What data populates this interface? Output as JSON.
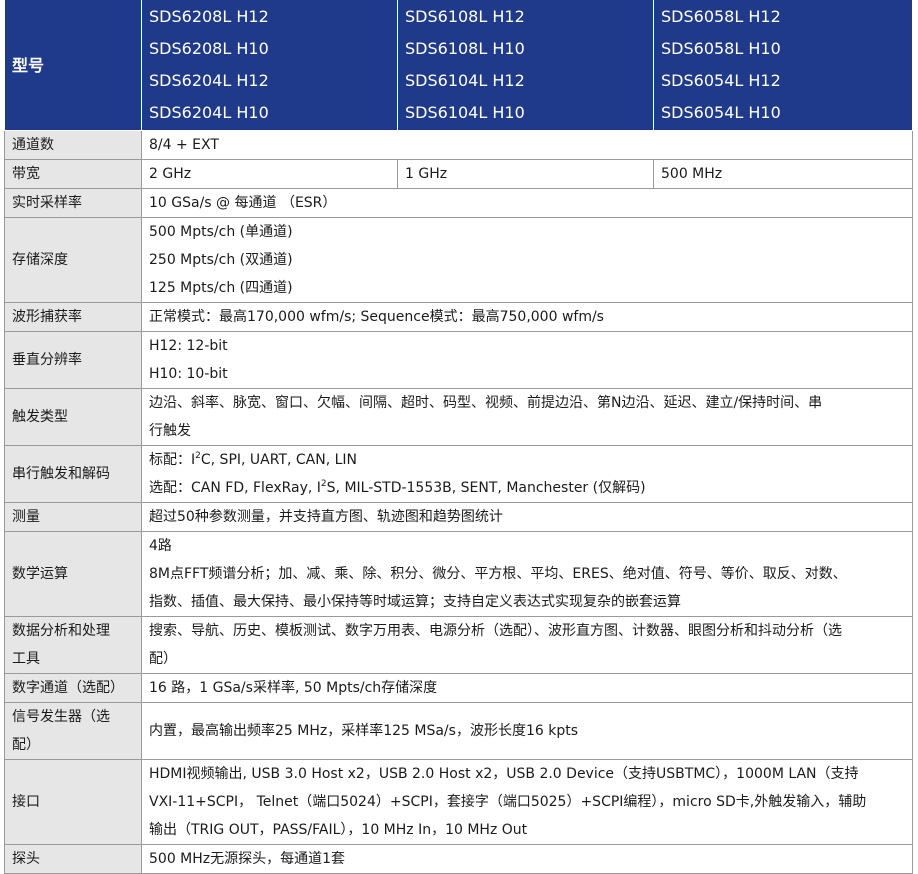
{
  "header": {
    "label": "型号",
    "models": [
      [
        "SDS6208L H12",
        "SDS6208L H10",
        "SDS6204L H12",
        "SDS6204L H10"
      ],
      [
        "SDS6108L H12",
        "SDS6108L H10",
        "SDS6104L H12",
        "SDS6104L H10"
      ],
      [
        "SDS6058L H12",
        "SDS6058L H10",
        "SDS6054L H12",
        "SDS6054L H10"
      ]
    ]
  },
  "rows": {
    "channels": {
      "label": "通道数",
      "value": "8/4 + EXT"
    },
    "bandwidth": {
      "label": "带宽",
      "values": [
        "2 GHz",
        "1 GHz",
        "500 MHz"
      ]
    },
    "sample_rate": {
      "label": "实时采样率",
      "value": "10 GSa/s @ 每通道 （ESR）"
    },
    "memory": {
      "label": "存储深度",
      "lines": [
        "500 Mpts/ch (单通道)",
        "250 Mpts/ch (双通道)",
        "125 Mpts/ch (四通道)"
      ]
    },
    "capture_rate": {
      "label": "波形捕获率",
      "value": "正常模式：最高170,000 wfm/s; Sequence模式：最高750,000 wfm/s"
    },
    "resolution": {
      "label": "垂直分辨率",
      "lines": [
        "H12: 12-bit",
        "H10: 10-bit"
      ]
    },
    "trigger": {
      "label": "触发类型",
      "lines": [
        "边沿、斜率、脉宽、窗口、欠幅、间隔、超时、码型、视频、前提边沿、第N边沿、延迟、建立/保持时间、串",
        "行触发"
      ]
    },
    "serial": {
      "label": "串行触发和解码",
      "line1_prefix": "标配：I",
      "line1_sup": "2",
      "line1_suffix": "C, SPI, UART, CAN, LIN",
      "line2_prefix": "选配：CAN FD, FlexRay, I",
      "line2_sup": "2",
      "line2_suffix": "S, MIL-STD-1553B, SENT, Manchester (仅解码)"
    },
    "measure": {
      "label": "测量",
      "value": "超过50种参数测量，并支持直方图、轨迹图和趋势图统计"
    },
    "math": {
      "label": "数学运算",
      "lines": [
        "4路",
        "8M点FFT频谱分析；加、减、乘、除、积分、微分、平方根、平均、ERES、绝对值、符号、等价、取反、对数、",
        "指数、插值、最大保持、最小保持等时域运算；支持自定义表达式实现复杂的嵌套运算"
      ]
    },
    "analysis": {
      "label_lines": [
        "数据分析和处理",
        "工具"
      ],
      "lines": [
        "搜索、导航、历史、模板测试、数字万用表、电源分析（选配）、波形直方图、计数器、眼图分析和抖动分析（选",
        "配）"
      ]
    },
    "digital": {
      "label": "数字通道（选配）",
      "value": "16 路，1 GSa/s采样率, 50 Mpts/ch存储深度"
    },
    "generator": {
      "label_lines": [
        "信号发生器（选",
        "配）"
      ],
      "value": "内置，最高输出频率25 MHz，采样率125 MSa/s，波形长度16 kpts"
    },
    "interface": {
      "label": "接口",
      "lines": [
        "HDMI视频输出, USB 3.0 Host x2，USB 2.0 Host x2，USB 2.0 Device（支持USBTMC），1000M LAN（支持",
        "VXI-11+SCPI， Telnet（端口5024）+SCPI，套接字（端口5025）+SCPI编程），micro SD卡,外触发输入，辅助",
        "输出（TRIG OUT，PASS/FAIL），10 MHz In，10 MHz Out"
      ]
    },
    "probe": {
      "label": "探头",
      "value": "500 MHz无源探头，每通道1套"
    }
  },
  "colors": {
    "header_bg": "#1f3a8a",
    "label_bg": "#e6e6e6",
    "border": "#9a9a9a"
  }
}
